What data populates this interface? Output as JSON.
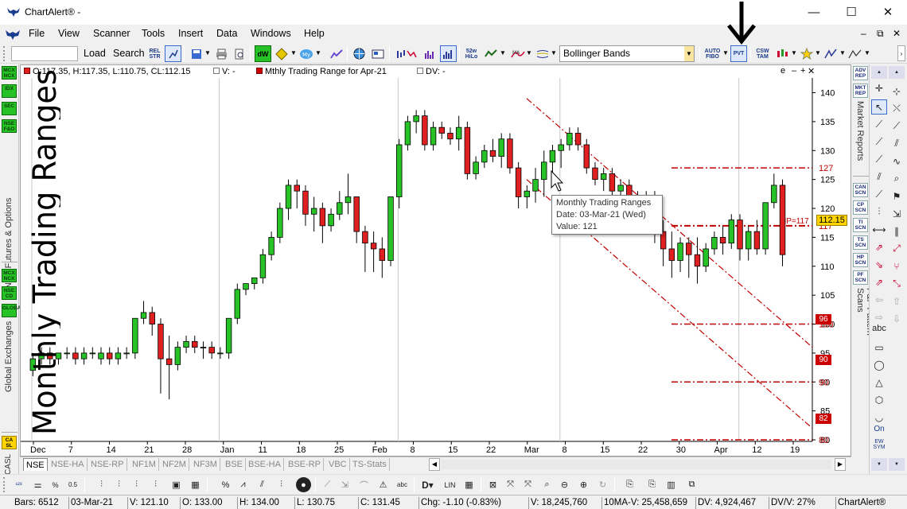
{
  "window": {
    "title": "ChartAlert® -",
    "minimize": "—",
    "maximize": "☐",
    "close": "✕"
  },
  "menu": [
    "File",
    "View",
    "Scanner",
    "Tools",
    "Insert",
    "Data",
    "Windows",
    "Help"
  ],
  "mdi_controls": [
    "–",
    "⧉",
    "✕"
  ],
  "toolbar": {
    "load": "Load",
    "search": "Search",
    "rel_str": "REL STR",
    "icon_52w": "52w HiLo",
    "indicator_dropdown": "Bollinger Bands",
    "auto_fibo": "AUTO FIBO",
    "pvt": "PVT",
    "csw_tam": "CSW TAM"
  },
  "left_badges_top": [
    "MCX NCX",
    "IDX",
    "SEC",
    "NSE F&O"
  ],
  "left_label_top": "NSE Futures & Options",
  "left_badges_bottom": [
    "MCX NCX",
    "NSE CD",
    "GLOBAL"
  ],
  "left_label_bottom": "Global Exchanges",
  "right_badges_top": [
    "ADV REP",
    "MKT REP"
  ],
  "right_label_top": "Market Reports",
  "right_badges_scan": [
    "CAN SCN",
    "CP SCN",
    "TI SCN",
    "TS SCN",
    "HP SCN",
    "PF SCN"
  ],
  "right_label_scan": "P&F Pattern Scans",
  "chart_header": {
    "ohlc": "O:117.35, H:117.35, L:110.75, CL:112.15",
    "volume": "V: -",
    "indicator": "Mthly Trading Range for Apr-21",
    "dv": "DV: -",
    "controls": [
      "e",
      "–",
      "+",
      "✕"
    ]
  },
  "overlay_title": "Monthly Trading Ranges",
  "tooltip": {
    "title": "Monthly Trading Ranges",
    "date": "Date: 03-Mar-21 (Wed)",
    "value": "Value: 121"
  },
  "hp_label": "HP=117",
  "current_price": "112.15",
  "price_tags": [
    "96",
    "90",
    "82"
  ],
  "tool_column_labels": {
    "text": "abc",
    "on": "On",
    "ew_sym": "EW SYM"
  },
  "tabs": [
    "NSE",
    "NSE-HA",
    "NSE-RP",
    "NF1M",
    "NF2M",
    "NF3M",
    "BSE",
    "BSE-HA",
    "BSE-RP",
    "VBC",
    "TS-Stats"
  ],
  "status": {
    "bars": "Bars: 6512",
    "date": "03-Mar-21",
    "v": "V: 121.10",
    "o": "O: 133.00",
    "h": "H: 134.00",
    "l": "L: 130.75",
    "c": "C: 131.45",
    "chg": "Chg: -1.10 (-0.83%)",
    "vol": "V: 18,245,760",
    "ma": "10MA-V: 25,458,659",
    "dv": "DV: 4,924,467",
    "dvv": "DV/V: 27%",
    "brand": "ChartAlert®"
  },
  "colors": {
    "up": "#26c226",
    "down": "#e02020",
    "range_line": "#c00000"
  },
  "chart_data": {
    "type": "candlestick",
    "title": "Mthly Trading Range for Apr-21",
    "ylim": [
      80,
      142
    ],
    "y_ticks": [
      80,
      85,
      90,
      95,
      100,
      105,
      110,
      115,
      120,
      125,
      130,
      135,
      140
    ],
    "x_ticks": [
      "Dec",
      "7",
      "14",
      "21",
      "28",
      "Jan",
      "11",
      "18",
      "25",
      "Feb",
      "8",
      "15",
      "22",
      "Mar",
      "8",
      "15",
      "22",
      "30",
      "Apr",
      "12",
      "19"
    ],
    "horizontal_levels": [
      127,
      117,
      100,
      90,
      80
    ],
    "candles": [
      [
        92,
        95,
        91,
        94
      ],
      [
        94,
        96,
        93,
        95
      ],
      [
        95,
        96,
        93,
        94
      ],
      [
        94,
        95,
        93,
        95
      ],
      [
        95,
        96,
        94,
        95
      ],
      [
        95,
        96,
        93,
        94
      ],
      [
        94,
        96,
        93,
        95
      ],
      [
        95,
        96,
        94,
        95
      ],
      [
        94,
        96,
        93,
        95
      ],
      [
        95,
        96,
        93,
        94
      ],
      [
        94,
        96,
        93,
        95
      ],
      [
        95,
        96,
        94,
        95
      ],
      [
        95,
        101,
        94,
        101
      ],
      [
        101,
        104,
        100,
        102
      ],
      [
        102,
        103,
        98,
        100
      ],
      [
        100,
        101,
        88,
        94
      ],
      [
        94,
        98,
        87,
        93
      ],
      [
        93,
        97,
        92,
        96
      ],
      [
        96,
        98,
        95,
        97
      ],
      [
        97,
        98,
        95,
        96
      ],
      [
        96,
        97,
        94,
        96
      ],
      [
        96,
        97,
        94,
        95
      ],
      [
        95,
        96,
        94,
        95
      ],
      [
        95,
        101,
        94,
        101
      ],
      [
        101,
        107,
        100,
        106
      ],
      [
        106,
        107,
        105,
        107
      ],
      [
        107,
        108,
        106,
        108
      ],
      [
        108,
        113,
        107,
        112
      ],
      [
        112,
        116,
        111,
        115
      ],
      [
        115,
        121,
        114,
        120
      ],
      [
        120,
        125,
        118,
        124
      ],
      [
        124,
        125,
        120,
        123
      ],
      [
        123,
        124,
        117,
        119
      ],
      [
        119,
        122,
        116,
        120
      ],
      [
        120,
        121,
        114,
        117
      ],
      [
        117,
        120,
        116,
        119
      ],
      [
        119,
        123,
        118,
        121
      ],
      [
        121,
        126,
        119,
        122
      ],
      [
        122,
        122,
        114,
        116
      ],
      [
        116,
        117,
        109,
        114
      ],
      [
        114,
        116,
        109,
        113
      ],
      [
        113,
        115,
        108,
        111
      ],
      [
        111,
        122,
        110,
        122
      ],
      [
        122,
        132,
        120,
        131
      ],
      [
        131,
        136,
        130,
        135
      ],
      [
        135,
        137,
        133,
        136
      ],
      [
        136,
        137,
        130,
        131
      ],
      [
        131,
        135,
        130,
        134
      ],
      [
        134,
        135,
        132,
        133
      ],
      [
        133,
        134,
        131,
        132
      ],
      [
        132,
        136,
        130,
        134
      ],
      [
        134,
        135,
        125,
        126
      ],
      [
        126,
        129,
        125,
        128
      ],
      [
        128,
        131,
        127,
        130
      ],
      [
        130,
        132,
        128,
        129
      ],
      [
        129,
        133,
        127,
        132
      ],
      [
        132,
        133,
        126,
        127
      ],
      [
        127,
        128,
        120,
        122
      ],
      [
        122,
        124,
        120,
        123
      ],
      [
        123,
        127,
        121,
        125
      ],
      [
        125,
        130,
        122,
        128
      ],
      [
        128,
        131,
        126,
        130
      ],
      [
        130,
        132,
        127,
        131
      ],
      [
        131,
        134,
        130,
        133
      ],
      [
        133,
        134,
        130,
        131
      ],
      [
        131,
        132,
        126,
        127
      ],
      [
        127,
        128,
        124,
        125
      ],
      [
        125,
        127,
        123,
        126
      ],
      [
        126,
        127,
        120,
        123
      ],
      [
        123,
        125,
        121,
        124
      ],
      [
        124,
        125,
        120,
        122
      ],
      [
        122,
        123,
        119,
        121
      ],
      [
        121,
        123,
        116,
        122
      ],
      [
        122,
        123,
        114,
        116
      ],
      [
        116,
        118,
        110,
        113
      ],
      [
        113,
        116,
        108,
        111
      ],
      [
        111,
        115,
        109,
        114
      ],
      [
        114,
        115,
        108,
        112
      ],
      [
        112,
        115,
        107,
        110
      ],
      [
        110,
        114,
        109,
        113
      ],
      [
        113,
        116,
        112,
        115
      ],
      [
        115,
        117,
        112,
        114
      ],
      [
        114,
        119,
        113,
        118
      ],
      [
        118,
        119,
        111,
        113
      ],
      [
        113,
        117,
        111,
        116
      ],
      [
        116,
        118,
        112,
        113
      ],
      [
        113,
        121,
        112,
        121
      ],
      [
        121,
        126,
        120,
        124
      ],
      [
        124,
        125,
        110,
        112
      ]
    ]
  }
}
